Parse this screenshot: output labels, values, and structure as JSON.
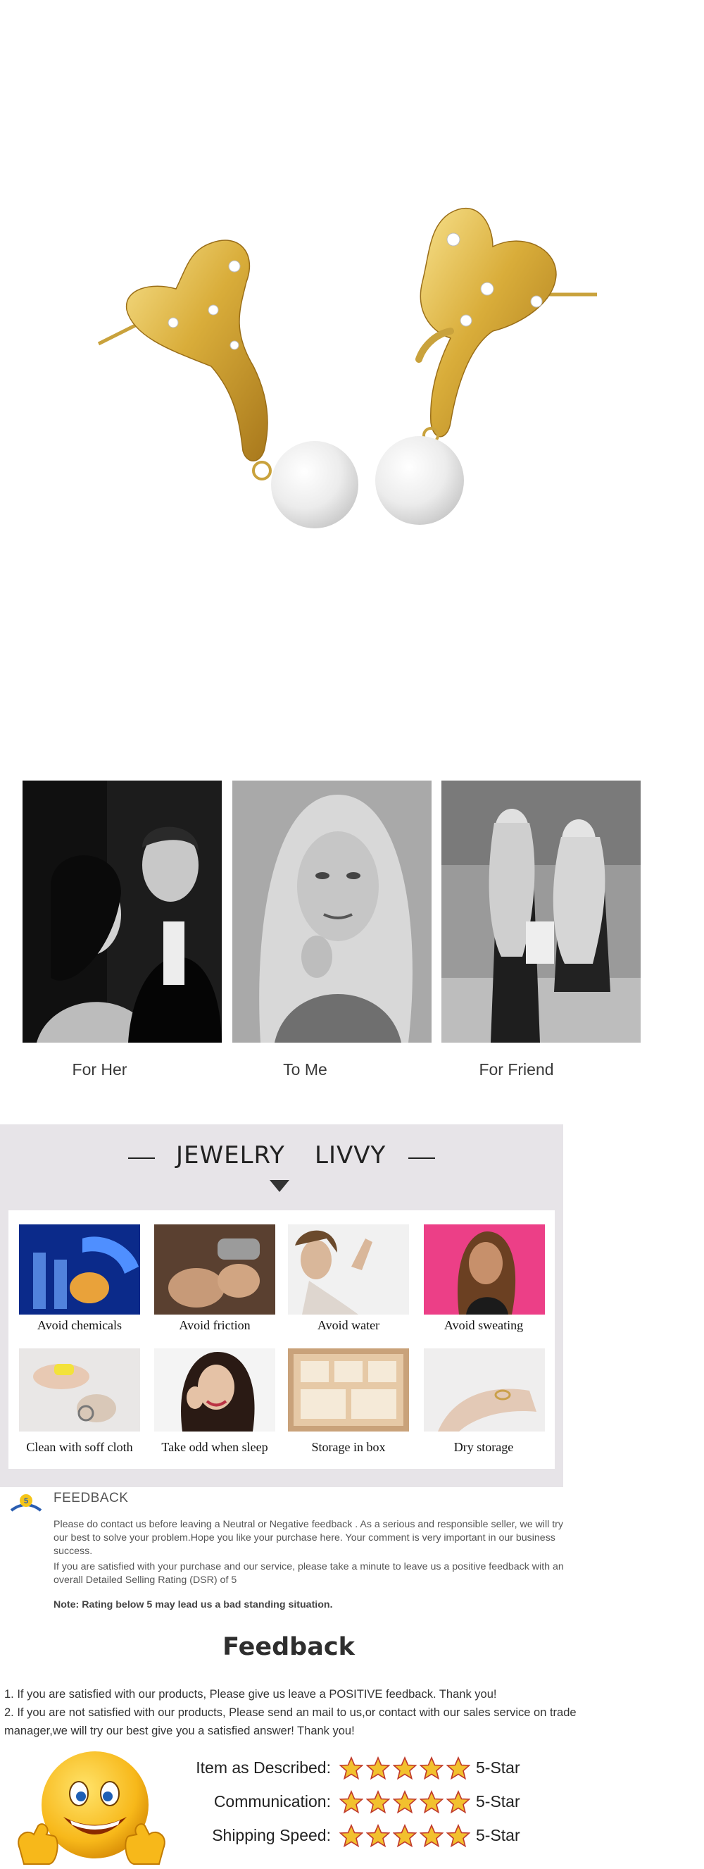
{
  "gifts": [
    {
      "label": "For Her"
    },
    {
      "label": "To Me"
    },
    {
      "label": "For Friend"
    }
  ],
  "brand": {
    "left": "JEWELRY",
    "right": "LIVVY"
  },
  "care": [
    {
      "label": "Avoid chemicals"
    },
    {
      "label": "Avoid friction"
    },
    {
      "label": "Avoid water"
    },
    {
      "label": "Avoid sweating"
    },
    {
      "label": "Clean with soff cloth"
    },
    {
      "label": "Take odd when sleep"
    },
    {
      "label": "Storage in box"
    },
    {
      "label": "Dry storage"
    }
  ],
  "feedback_note": {
    "heading": "FEEDBACK",
    "para1": "Please do contact us before leaving a Neutral or Negative  feedback . As a serious and responsible seller, we will try our best to solve your problem.Hope you like your purchase here. Your comment is very important in our business success.",
    "para2": " If you are satisfied with your purchase and our service,  please take a minute to leave us  a positive feedback with an overall  Detailed Selling Rating (DSR) of 5",
    "note": "Note: Rating below 5 may lead us a bad standing situation."
  },
  "feedback": {
    "title": "Feedback",
    "line1": "1. If you are satisfied with our products, Please give us leave a POSITIVE feedback. Thank you!",
    "line2": "2. If you are not satisfied with our products, Please send an mail to us,or contact with our sales service on trade manager,we will try our best give you a satisfied answer! Thank you!"
  },
  "ratings": [
    {
      "label": "Item as Described:",
      "stars": 5,
      "value": "5-Star"
    },
    {
      "label": "Communication:",
      "stars": 5,
      "value": "5-Star"
    },
    {
      "label": "Shipping Speed:",
      "stars": 5,
      "value": "5-Star"
    }
  ],
  "colors": {
    "gold": "#d8ae3c",
    "pearl": "#f2f2f2",
    "panel": "#e7e4e8",
    "star": "#f2c12e"
  }
}
